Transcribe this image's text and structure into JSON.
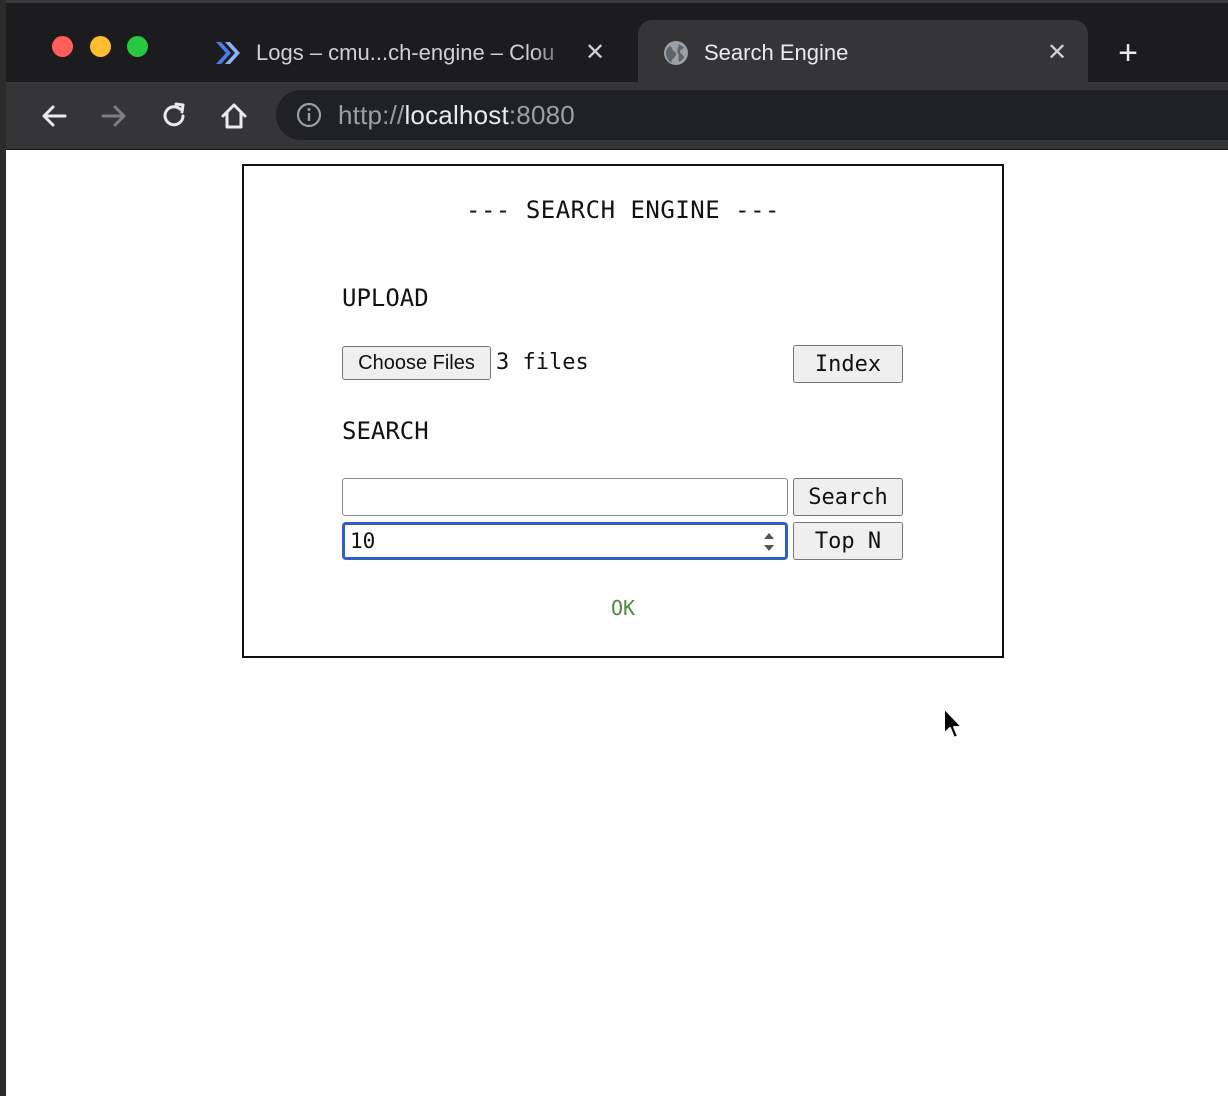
{
  "browser": {
    "tabs": [
      {
        "title": "Logs – cmu...ch-engine – Clou",
        "favicon": "cloud-run-icon",
        "active": false
      },
      {
        "title": "Search Engine",
        "favicon": "globe-icon",
        "active": true
      }
    ],
    "close_glyph": "✕",
    "new_tab_glyph": "+",
    "url": {
      "scheme": "http://",
      "host": "localhost",
      "port": ":8080"
    }
  },
  "app": {
    "title": "--- SEARCH ENGINE ---",
    "upload": {
      "heading": "UPLOAD",
      "choose_files_label": "Choose Files",
      "file_status": "3 files",
      "index_button": "Index"
    },
    "search": {
      "heading": "SEARCH",
      "query_value": "",
      "search_button": "Search",
      "topn_value": "10",
      "topn_button": "Top N"
    },
    "status_text": "OK",
    "colors": {
      "status_ok": "#4e8a3a",
      "focus_ring": "#2f5fc4"
    }
  }
}
